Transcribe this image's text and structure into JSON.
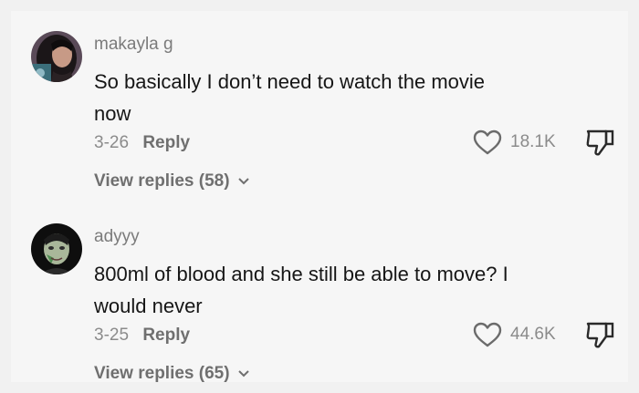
{
  "comments": [
    {
      "username": "makayla g",
      "text": "So basically I don’t need to watch the movie now",
      "date": "3-26",
      "reply_label": "Reply",
      "likes": "18.1K",
      "view_replies": "View replies (58)"
    },
    {
      "username": "adyyy",
      "text": "800ml of blood and she still be able to move? I would never",
      "date": "3-25",
      "reply_label": "Reply",
      "likes": "44.6K",
      "view_replies": "View replies (65)"
    }
  ],
  "icons": {
    "like": "heart-outline-icon",
    "dislike": "thumbs-down-icon",
    "expand": "chevron-down-icon"
  },
  "colors": {
    "username": "#7b7b7b",
    "comment_text": "#161616",
    "meta": "#8b8b8b"
  }
}
